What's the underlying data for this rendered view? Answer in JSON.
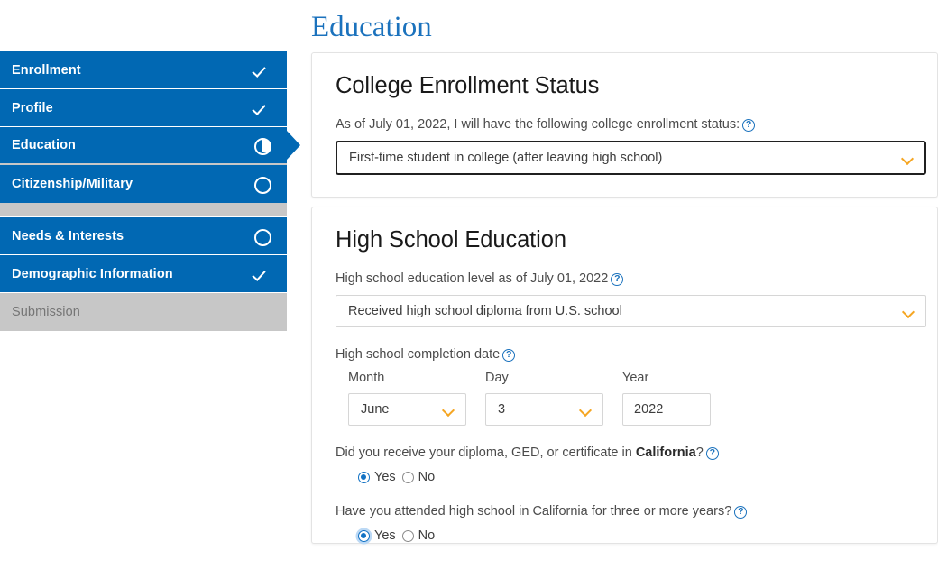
{
  "sidebar": {
    "items": [
      {
        "label": "Enrollment",
        "icon": "check-icon",
        "state": "complete"
      },
      {
        "label": "Profile",
        "icon": "check-icon",
        "state": "complete"
      },
      {
        "label": "Education",
        "icon": "half-circle-icon",
        "state": "in-progress"
      },
      {
        "label": "Citizenship/Military",
        "icon": "empty-circle-icon",
        "state": "not-started"
      },
      {
        "label": "Needs & Interests",
        "icon": "empty-circle-icon",
        "state": "not-started"
      },
      {
        "label": "Demographic Information",
        "icon": "check-icon",
        "state": "complete"
      },
      {
        "label": "Submission",
        "icon": "none",
        "state": "disabled"
      }
    ]
  },
  "page": {
    "title": "Education"
  },
  "college_status": {
    "heading": "College Enrollment Status",
    "question": "As of July 01, 2022, I will have the following college enrollment status:",
    "help_icon": "?",
    "select_value": "First-time student in college (after leaving high school)",
    "chevron_icon": "chevron-down-icon"
  },
  "high_school": {
    "heading": "High School Education",
    "level_label": "High school education level as of July 01, 2022",
    "level_value": "Received high school diploma from U.S. school",
    "completion_label": "High school completion date",
    "date": {
      "month_label": "Month",
      "month_value": "June",
      "day_label": "Day",
      "day_value": "3",
      "year_label": "Year",
      "year_value": "2022"
    },
    "q1": {
      "text_before": "Did you receive your diploma, GED, or certificate in ",
      "bold": "California",
      "text_after": "?",
      "yes_label": "Yes",
      "no_label": "No",
      "selected": "Yes"
    },
    "q2": {
      "text": "Have you attended high school in California for three or more years?",
      "yes_label": "Yes",
      "no_label": "No",
      "selected": "Yes"
    }
  },
  "colors": {
    "sidebar_blue": "#0168b3",
    "title_blue": "#1b72bd",
    "chevron_orange": "#f5a623",
    "radio_blue": "#1272c4",
    "disabled_gray": "#c7c7c7"
  }
}
